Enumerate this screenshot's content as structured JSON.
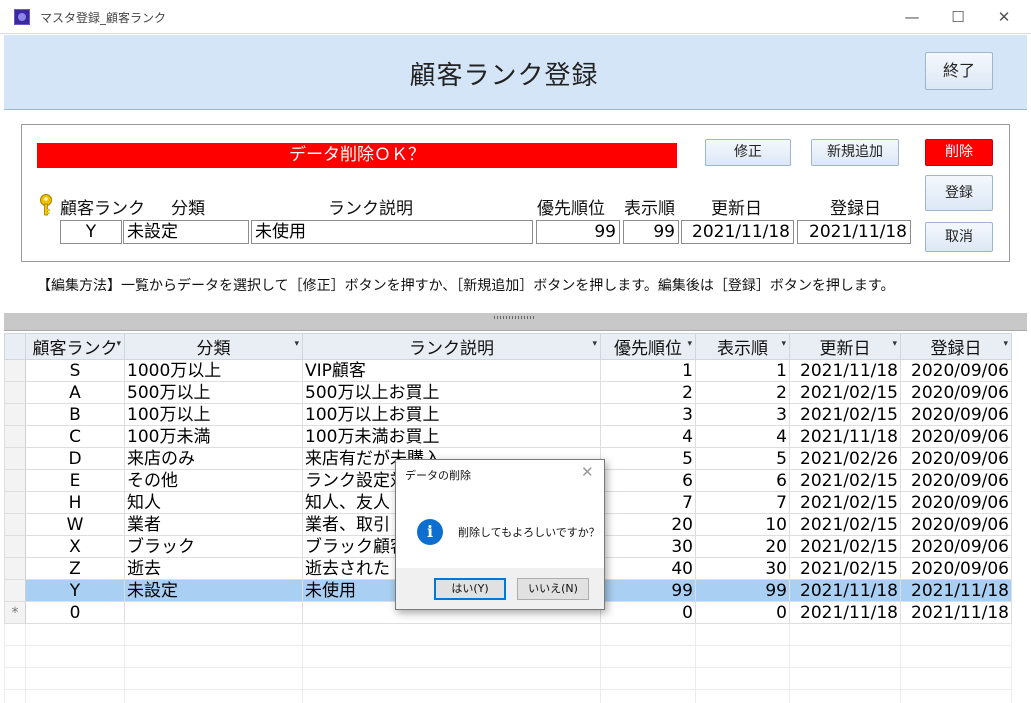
{
  "window": {
    "title": "マスタ登録_顧客ランク",
    "controls": {
      "minimize": "—",
      "maximize": "☐",
      "close": "✕"
    }
  },
  "header": {
    "title": "顧客ランク登録",
    "exit_label": "終了"
  },
  "form": {
    "warning": "データ削除ＯＫ？",
    "buttons": {
      "edit": "修正",
      "add": "新規追加",
      "delete": "削除",
      "save": "登録",
      "cancel": "取消"
    },
    "labels": {
      "rank": "顧客ランク",
      "category": "分類",
      "description": "ランク説明",
      "priority": "優先順位",
      "display_order": "表示順",
      "updated": "更新日",
      "registered": "登録日"
    },
    "values": {
      "rank": "Y",
      "category": "未設定",
      "description": "未使用",
      "priority": "99",
      "display_order": "99",
      "updated": "2021/11/18",
      "registered": "2021/11/18"
    },
    "help": "【編集方法】一覧からデータを選択して［修正］ボタンを押すか、［新規追加］ボタンを押します。編集後は［登録］ボタンを押します。"
  },
  "grid": {
    "headers": [
      "顧客ランク",
      "分類",
      "ランク説明",
      "優先順位",
      "表示順",
      "更新日",
      "登録日"
    ],
    "rows": [
      [
        "S",
        "1000万以上",
        "VIP顧客",
        "1",
        "1",
        "2021/11/18",
        "2020/09/06"
      ],
      [
        "A",
        "500万以上",
        "500万以上お買上",
        "2",
        "2",
        "2021/02/15",
        "2020/09/06"
      ],
      [
        "B",
        "100万以上",
        "100万以上お買上",
        "3",
        "3",
        "2021/02/15",
        "2020/09/06"
      ],
      [
        "C",
        "100万未満",
        "100万未満お買上",
        "4",
        "4",
        "2021/11/18",
        "2020/09/06"
      ],
      [
        "D",
        "来店のみ",
        "来店有だが未購入",
        "5",
        "5",
        "2021/02/26",
        "2020/09/06"
      ],
      [
        "E",
        "その他",
        "ランク設定対",
        "6",
        "6",
        "2021/02/15",
        "2020/09/06"
      ],
      [
        "H",
        "知人",
        "知人、友人",
        "7",
        "7",
        "2021/02/15",
        "2020/09/06"
      ],
      [
        "W",
        "業者",
        "業者、取引",
        "20",
        "10",
        "2021/02/15",
        "2020/09/06"
      ],
      [
        "X",
        "ブラック",
        "ブラック顧客",
        "30",
        "20",
        "2021/02/15",
        "2020/09/06"
      ],
      [
        "Z",
        "逝去",
        "逝去された",
        "40",
        "30",
        "2021/02/15",
        "2020/09/06"
      ],
      [
        "Y",
        "未設定",
        "未使用",
        "99",
        "99",
        "2021/11/18",
        "2021/11/18"
      ],
      [
        "0",
        "",
        "",
        "0",
        "0",
        "2021/11/18",
        "2021/11/18"
      ]
    ],
    "new_row_marker": "*",
    "current_row_index": 10
  },
  "dialog": {
    "title": "データの削除",
    "message": "削除してもよろしいですか？",
    "icon": "info-icon",
    "yes_label": "はい(Y)",
    "no_label": "いいえ(N)"
  },
  "colors": {
    "header_band": "#d5e5f8",
    "warning": "#ff0000",
    "selected_row": "#a9cff2",
    "dialog_focus": "#0078d7"
  }
}
